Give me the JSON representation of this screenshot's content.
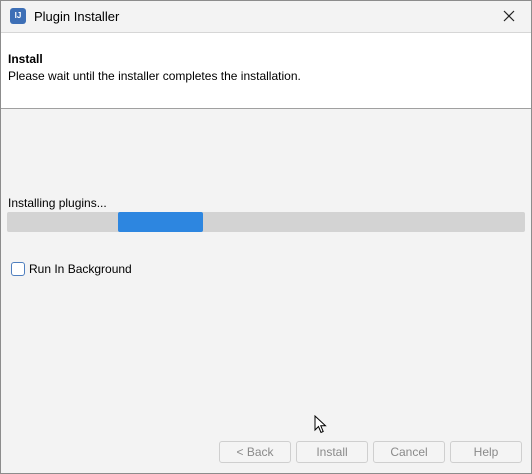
{
  "window": {
    "title": "Plugin Installer",
    "icon": "app-icon"
  },
  "header": {
    "title": "Install",
    "description": "Please wait until the installer completes the installation."
  },
  "progress": {
    "label": "Installing plugins...",
    "fill_start": 0.215,
    "fill_end": 0.38,
    "indeterminate": true,
    "color": "#2d86e0"
  },
  "options": {
    "run_in_background_label": "Run In Background",
    "run_in_background_checked": false
  },
  "buttons": {
    "back": "< Back",
    "install": "Install",
    "cancel": "Cancel",
    "help": "Help"
  },
  "colors": {
    "accent": "#2d86e0",
    "checkbox_border": "#4f7fbf"
  }
}
